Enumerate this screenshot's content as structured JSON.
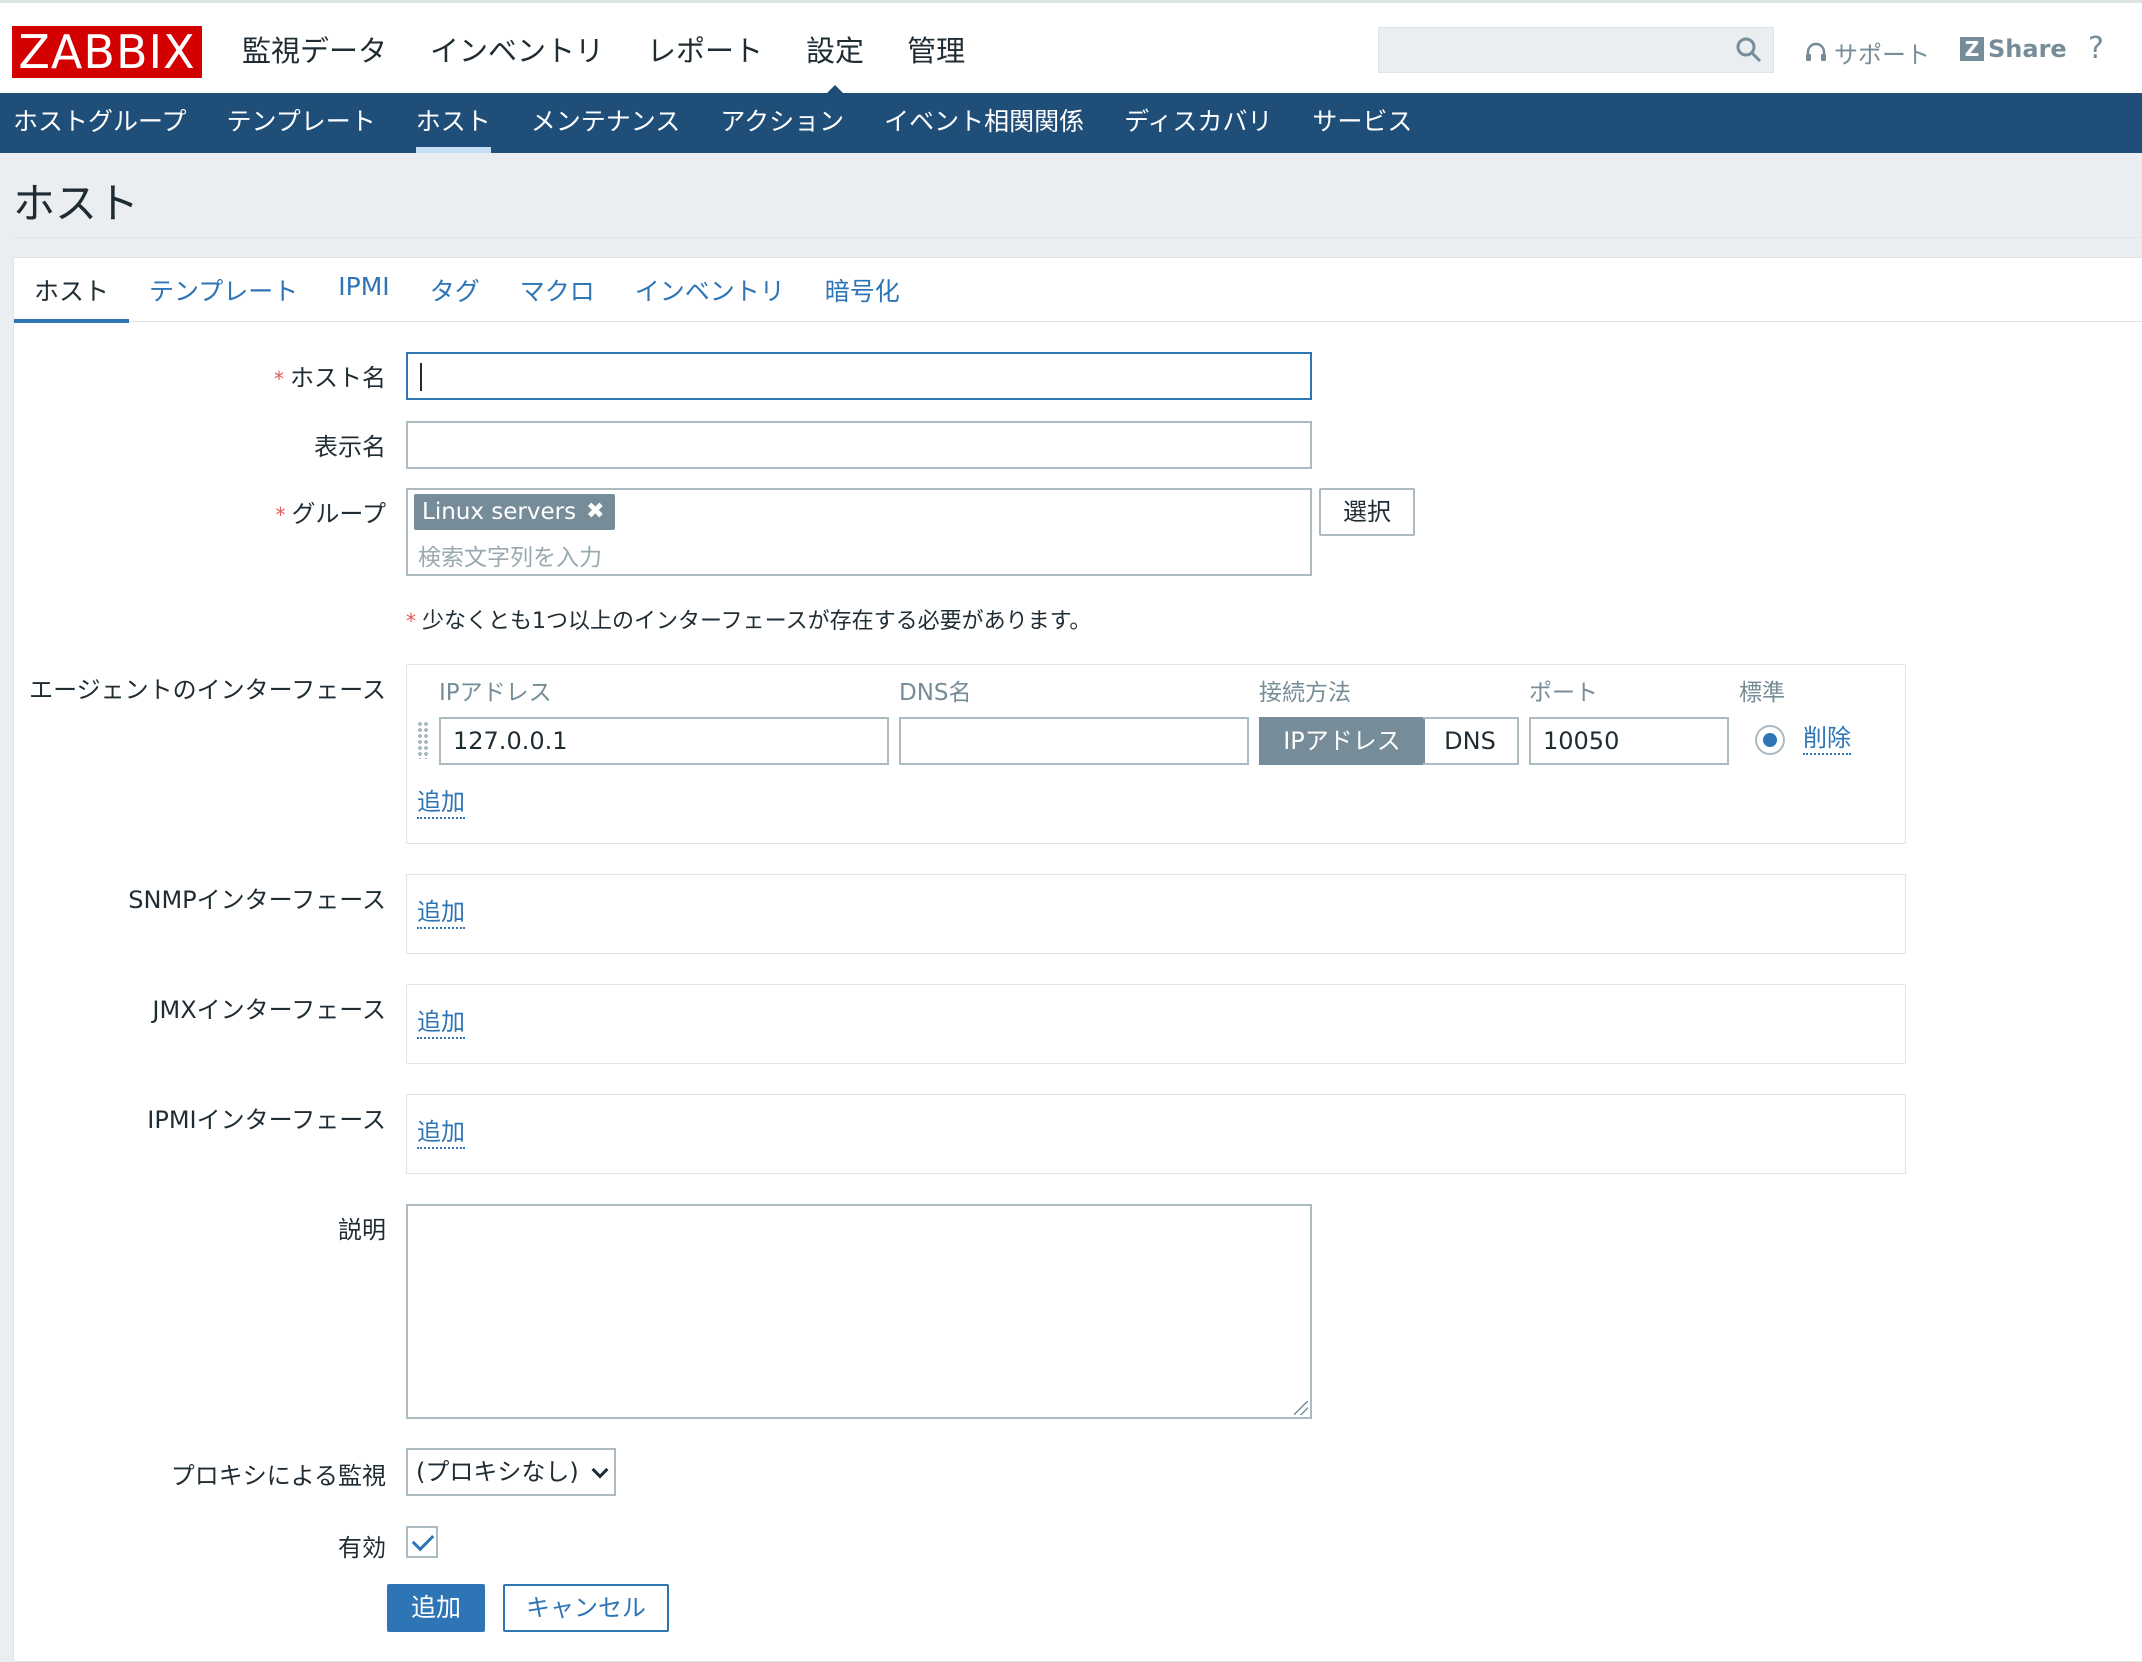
{
  "logo": "ZABBIX",
  "top_menu": [
    "監視データ",
    "インベントリ",
    "レポート",
    "設定",
    "管理"
  ],
  "top_menu_active": "設定",
  "header_right": {
    "support": "サポート",
    "share": "Share",
    "help": "?"
  },
  "sub_menu": [
    "ホストグループ",
    "テンプレート",
    "ホスト",
    "メンテナンス",
    "アクション",
    "イベント相関関係",
    "ディスカバリ",
    "サービス"
  ],
  "sub_menu_active": "ホスト",
  "page_title": "ホスト",
  "tabs": [
    "ホスト",
    "テンプレート",
    "IPMI",
    "タグ",
    "マクロ",
    "インベントリ",
    "暗号化"
  ],
  "form": {
    "host_name_label": "ホスト名",
    "host_name_value": "",
    "visible_name_label": "表示名",
    "visible_name_value": "",
    "groups_label": "グループ",
    "group_chip": "Linux servers",
    "group_chip_remove": "✖",
    "groups_placeholder": "検索文字列を入力",
    "select_button": "選択",
    "interface_note": "少なくとも1つ以上のインターフェースが存在する必要があります。",
    "agent_if_label": "エージェントのインターフェース",
    "col_ip": "IPアドレス",
    "col_dns": "DNS名",
    "col_connect": "接続方法",
    "col_port": "ポート",
    "col_default": "標準",
    "agent_ip": "127.0.0.1",
    "agent_dns": "",
    "connect_ip": "IPアドレス",
    "connect_dns": "DNS",
    "agent_port": "10050",
    "remove_link": "削除",
    "add_link": "追加",
    "snmp_if_label": "SNMPインターフェース",
    "jmx_if_label": "JMXインターフェース",
    "ipmi_if_label": "IPMIインターフェース",
    "description_label": "説明",
    "description_value": "",
    "proxy_label": "プロキシによる監視",
    "proxy_value": "(プロキシなし)",
    "enabled_label": "有効",
    "enabled": true,
    "add_button": "追加",
    "cancel_button": "キャンセル"
  },
  "colors": {
    "brand": "#d40000",
    "nav": "#1f4e79",
    "link": "#2e75b6",
    "required": "#e45959"
  }
}
